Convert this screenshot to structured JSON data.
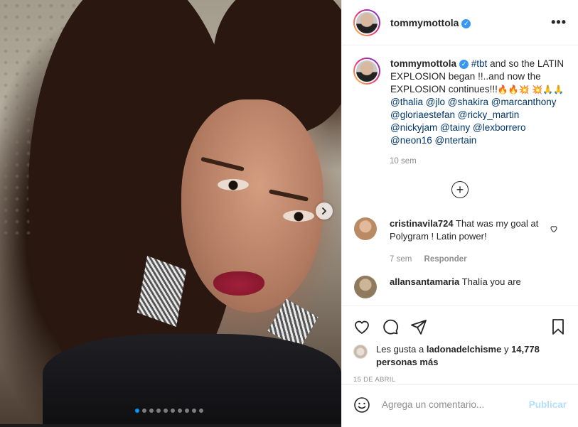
{
  "post": {
    "username": "tommymottola",
    "verified_badge": "✓",
    "more_icon": "more-options-icon",
    "carousel": {
      "slide_count": 10,
      "active_index": 0
    }
  },
  "caption": {
    "username": "tommymottola",
    "text_before": "#tbt and so the LATIN EXPLOSION began !!..and now the EXPLOSION continues!!!",
    "hashtag": "#tbt",
    "text_main": " and so the LATIN EXPLOSION began !!..and now the EXPLOSION continues!!!",
    "emojis_1": "🔥🔥💥",
    "emojis_2": "💥🙏🙏",
    "mentions": [
      "@thalia",
      "@jlo",
      "@shakira",
      "@marcanthony",
      "@gloriaestefan",
      "@ricky_martin",
      "@nickyjam",
      "@tainy",
      "@lexborrero",
      "@neon16",
      "@ntertain"
    ],
    "time": "10 sem"
  },
  "comments": [
    {
      "username": "cristinavila724",
      "text": "That was my goal at Polygram ! Latin power!",
      "time": "7 sem",
      "reply_label": "Responder"
    },
    {
      "username": "allansantamaria",
      "text": "Thalía you are"
    }
  ],
  "likes": {
    "prefix": "Les gusta a",
    "user": "ladonadelchisme",
    "conj": "y",
    "count_text": "14,778 personas más"
  },
  "date": "15 DE ABRIL",
  "composer": {
    "placeholder": "Agrega un comentario...",
    "publish_label": "Publicar"
  },
  "colors": {
    "accent": "#0095f6",
    "tag": "#00376b",
    "muted": "#8e8e8e",
    "publish_disabled": "#b2dffc"
  }
}
